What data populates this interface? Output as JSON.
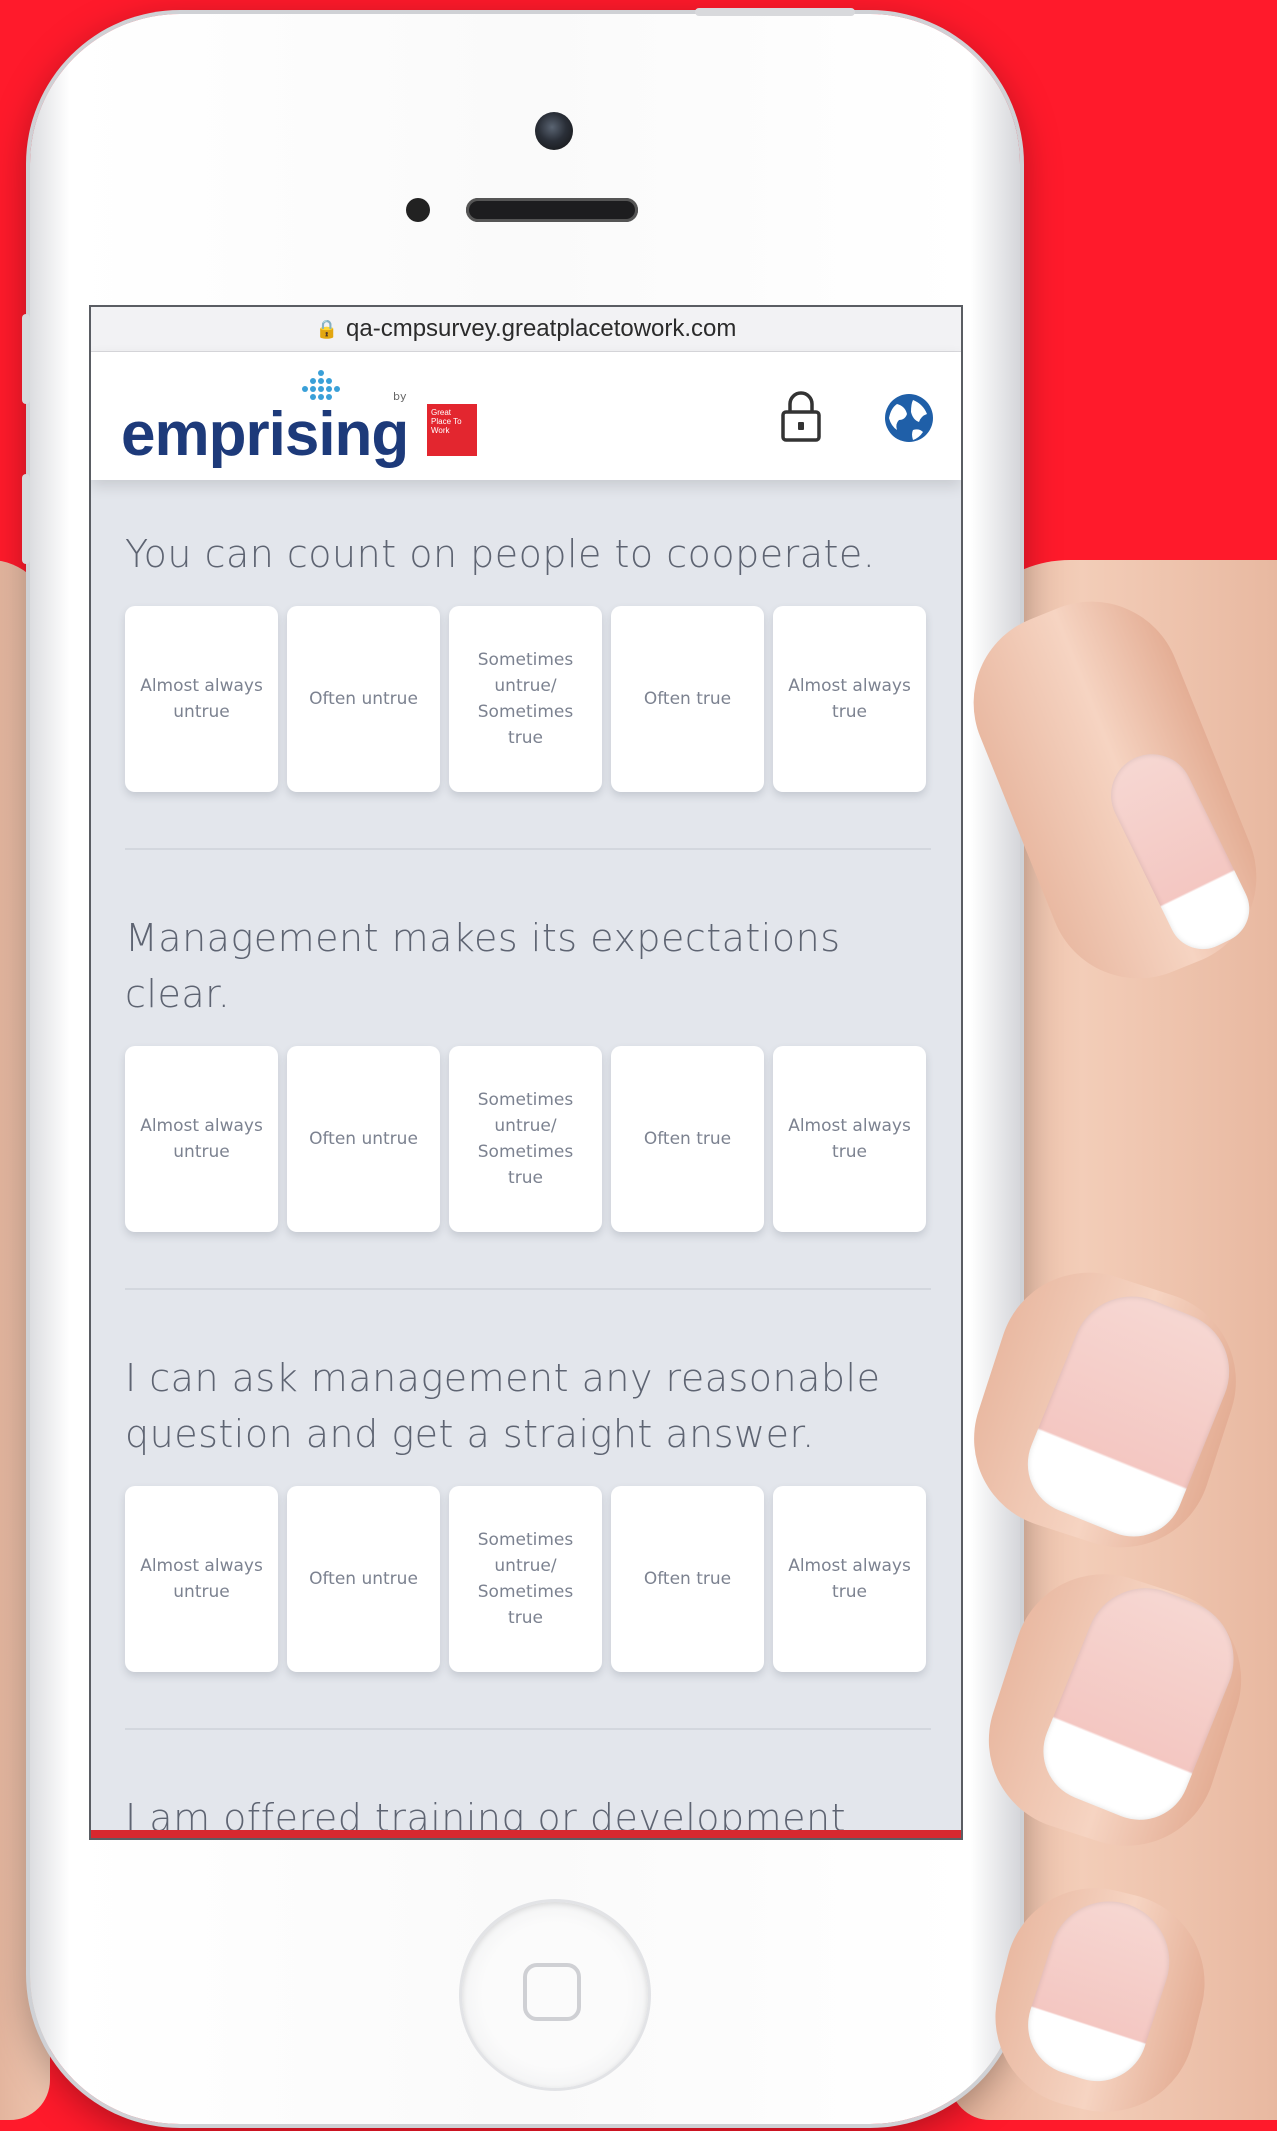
{
  "browser": {
    "url": "qa-cmpsurvey.greatplacetowork.com"
  },
  "header": {
    "logo_text": "emprising",
    "logo_by": "by",
    "badge_text": "Great Place To Work"
  },
  "options": [
    "Almost always untrue",
    "Often untrue",
    "Sometimes untrue/ Sometimes true",
    "Often true",
    "Almost always true"
  ],
  "questions": [
    {
      "text": "You can count on people to cooperate."
    },
    {
      "text": "Management makes its expectations clear."
    },
    {
      "text": "I can ask management any reasonable question and get a straight answer."
    },
    {
      "text": "I am offered training or development"
    }
  ],
  "colors": {
    "background": "#ff1a2b",
    "brand_blue": "#1d3a7a",
    "brand_red": "#e3262f",
    "globe_blue": "#1f5fa8"
  },
  "icons": [
    "lock-icon",
    "globe-icon"
  ]
}
